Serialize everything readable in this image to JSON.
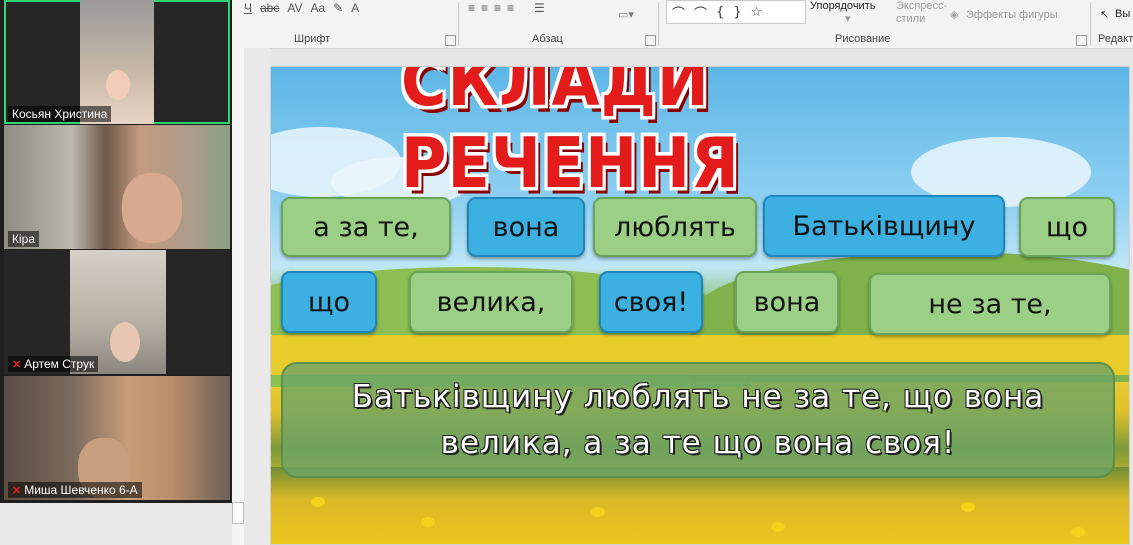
{
  "ribbon": {
    "font_group_label": "Шрифт",
    "paragraph_group_label": "Абзац",
    "drawing_group_label": "Рисование",
    "editing_group_label": "Редакт",
    "arrange_label": "Упорядочить",
    "quick_styles_label": "Экспресс-\nстили",
    "shape_effects_label": "Эффекты фигуры",
    "select_label": "Вы",
    "font_tools": [
      "Ч",
      "abc",
      "AV",
      "Aa",
      "A"
    ],
    "shape_glyphs": [
      "{",
      "}",
      "☆"
    ]
  },
  "participants": [
    {
      "name": "Косьян Христина",
      "muted": false,
      "active": true
    },
    {
      "name": "Кіра",
      "muted": false,
      "active": false
    },
    {
      "name": "Артем Струк",
      "muted": true,
      "active": false
    },
    {
      "name": "Миша Шевченко 6-А",
      "muted": true,
      "active": false
    }
  ],
  "slide": {
    "title": "СКЛАДИ РЕЧЕННЯ",
    "words_row1": [
      "а за те,",
      "вона",
      "люблять",
      "Батьківщину",
      "що"
    ],
    "words_row2": [
      "що",
      "велика,",
      "своя!",
      "вона",
      "не за те,"
    ],
    "answer": "Батьківщину люблять не за те, що вона велика, а за те що вона своя!"
  },
  "colors": {
    "title_red": "#e31b1b",
    "card_green": "#9ccf86",
    "card_blue": "#3cb0e0",
    "active_speaker": "#2ed573"
  }
}
